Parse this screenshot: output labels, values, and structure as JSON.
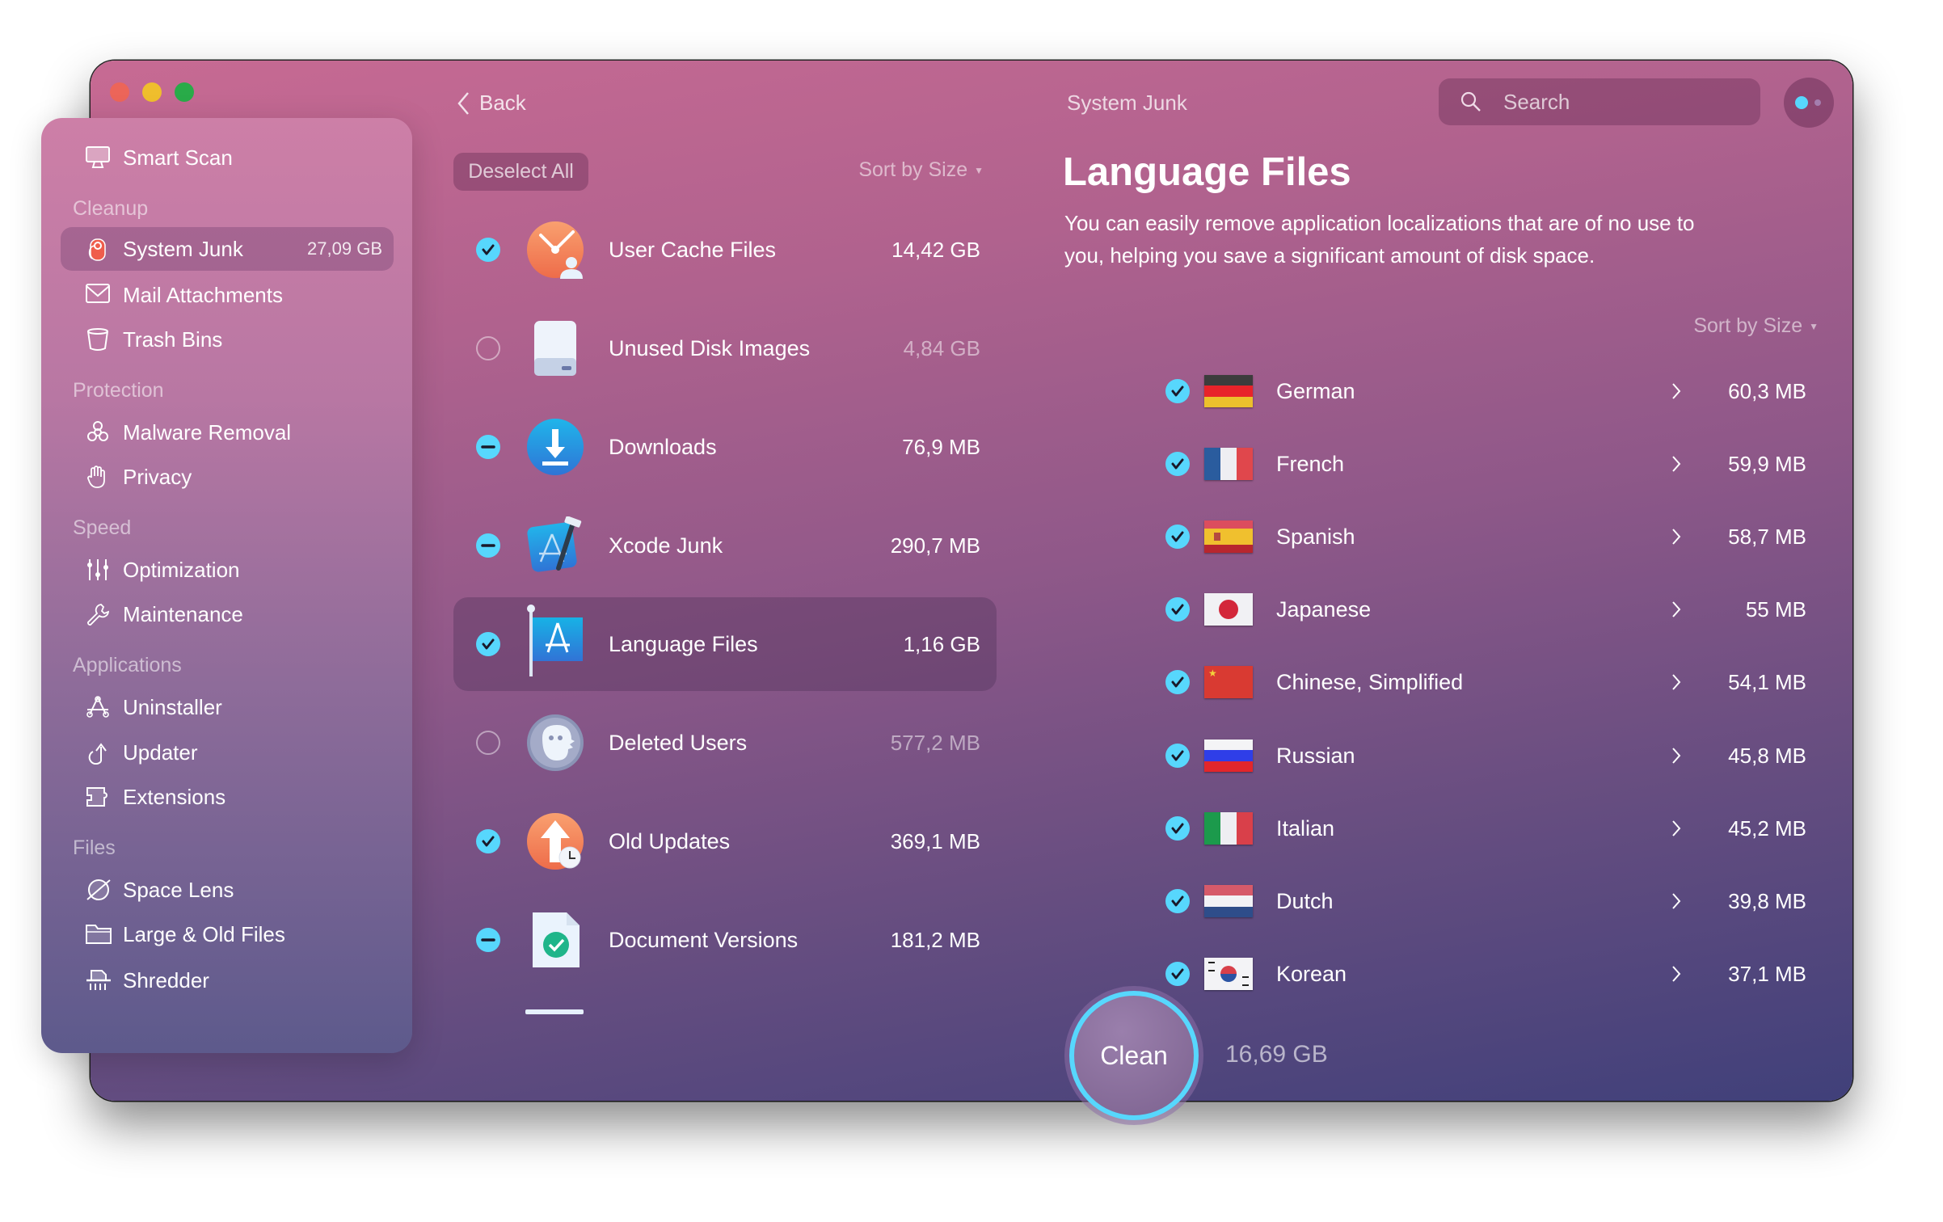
{
  "window": {
    "back_label": "Back",
    "title": "System Junk",
    "search_placeholder": "Search"
  },
  "sidebar": {
    "top_item": {
      "label": "Smart Scan",
      "icon": "smart-scan-icon"
    },
    "sections": [
      {
        "label": "Cleanup",
        "items": [
          {
            "label": "System Junk",
            "icon": "system-junk-icon",
            "size": "27,09 GB",
            "selected": true
          },
          {
            "label": "Mail Attachments",
            "icon": "mail-icon"
          },
          {
            "label": "Trash Bins",
            "icon": "trash-icon"
          }
        ]
      },
      {
        "label": "Protection",
        "items": [
          {
            "label": "Malware Removal",
            "icon": "biohazard-icon"
          },
          {
            "label": "Privacy",
            "icon": "hand-icon"
          }
        ]
      },
      {
        "label": "Speed",
        "items": [
          {
            "label": "Optimization",
            "icon": "sliders-icon"
          },
          {
            "label": "Maintenance",
            "icon": "wrench-icon"
          }
        ]
      },
      {
        "label": "Applications",
        "items": [
          {
            "label": "Uninstaller",
            "icon": "uninstaller-icon"
          },
          {
            "label": "Updater",
            "icon": "updater-icon"
          },
          {
            "label": "Extensions",
            "icon": "puzzle-icon"
          }
        ]
      },
      {
        "label": "Files",
        "items": [
          {
            "label": "Space Lens",
            "icon": "space-lens-icon"
          },
          {
            "label": "Large & Old Files",
            "icon": "folder-icon"
          },
          {
            "label": "Shredder",
            "icon": "shredder-icon"
          }
        ]
      }
    ]
  },
  "middle": {
    "deselect_all_label": "Deselect All",
    "sort_label": "Sort by Size",
    "items": [
      {
        "name": "User Cache Files",
        "size": "14,42 GB",
        "state": "checked",
        "icon": "user-cache-icon"
      },
      {
        "name": "Unused Disk Images",
        "size": "4,84 GB",
        "state": "unchecked",
        "icon": "disk-image-icon"
      },
      {
        "name": "Downloads",
        "size": "76,9 MB",
        "state": "partial",
        "icon": "downloads-icon"
      },
      {
        "name": "Xcode Junk",
        "size": "290,7 MB",
        "state": "partial",
        "icon": "xcode-icon"
      },
      {
        "name": "Language Files",
        "size": "1,16 GB",
        "state": "checked",
        "icon": "language-flag-icon",
        "selected": true
      },
      {
        "name": "Deleted Users",
        "size": "577,2 MB",
        "state": "unchecked",
        "icon": "deleted-users-icon"
      },
      {
        "name": "Old Updates",
        "size": "369,1 MB",
        "state": "checked",
        "icon": "old-updates-icon"
      },
      {
        "name": "Document Versions",
        "size": "181,2 MB",
        "state": "partial",
        "icon": "document-versions-icon"
      }
    ]
  },
  "detail": {
    "title": "Language Files",
    "description_line1": "You can easily remove application localizations that are of no use to",
    "description_line2": "you, helping you save a significant amount of disk space.",
    "sort_label": "Sort by Size",
    "languages": [
      {
        "name": "German",
        "size": "60,3 MB",
        "checked": true,
        "flag": "de"
      },
      {
        "name": "French",
        "size": "59,9 MB",
        "checked": true,
        "flag": "fr"
      },
      {
        "name": "Spanish",
        "size": "58,7 MB",
        "checked": true,
        "flag": "es"
      },
      {
        "name": "Japanese",
        "size": "55 MB",
        "checked": true,
        "flag": "jp"
      },
      {
        "name": "Chinese, Simplified",
        "size": "54,1 MB",
        "checked": true,
        "flag": "cn"
      },
      {
        "name": "Russian",
        "size": "45,8 MB",
        "checked": true,
        "flag": "ru"
      },
      {
        "name": "Italian",
        "size": "45,2 MB",
        "checked": true,
        "flag": "it"
      },
      {
        "name": "Dutch",
        "size": "39,8 MB",
        "checked": true,
        "flag": "nl"
      },
      {
        "name": "Korean",
        "size": "37,1 MB",
        "checked": true,
        "flag": "kr"
      }
    ]
  },
  "footer": {
    "clean_label": "Clean",
    "total_size": "16,69 GB"
  },
  "colors": {
    "accent": "#57d7fd",
    "close": "#ec6559",
    "minimize": "#efbe2d",
    "zoom": "#29ab49"
  }
}
